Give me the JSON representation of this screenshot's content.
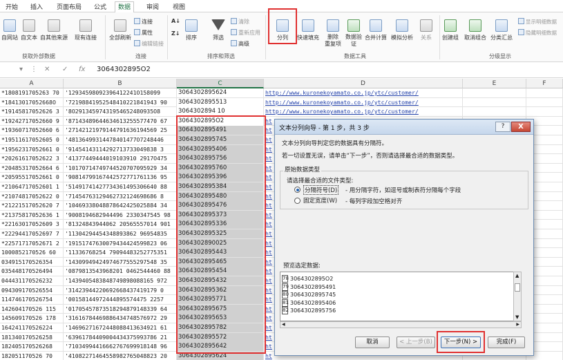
{
  "ribbon": {
    "tabs": [
      "开始",
      "插入",
      "页面布局",
      "公式",
      "数据",
      "审阅",
      "视图"
    ],
    "external": [
      "自网站",
      "自文本",
      "自其他来源",
      "现有连接"
    ],
    "refresh": "全部刷新",
    "connections": [
      "连接",
      "属性",
      "编辑链接"
    ],
    "sort": "排序",
    "filter": "筛选",
    "filter_small": [
      "清除",
      "重新应用",
      "高级"
    ],
    "text_to_columns": "分列",
    "tools": [
      "快速填充",
      "删除\n重复项",
      "数据验\n证",
      "合并计算",
      "模拟分析",
      "关系"
    ],
    "outline": [
      "创建组",
      "取消组合",
      "分类汇总"
    ],
    "outline_small": [
      "显示明细数据",
      "隐藏明细数据"
    ],
    "groups": [
      "获取外部数据",
      "连接",
      "排序和筛选",
      "数据工具",
      "分级显示"
    ]
  },
  "formula_bar": {
    "name_box": "",
    "value": "3064302895O2"
  },
  "columns": [
    "A",
    "B",
    "C",
    "D",
    "E",
    "F"
  ],
  "sheet": {
    "rows": [
      [
        "*1808191705263 70",
        "'12934598092396412241O158099",
        "3064302895624",
        "http://www.kuronekoyamato.co.jp/ytc/customer/"
      ],
      [
        "*18413017052668O",
        "'72198841952548410221841943 90",
        "3064302895513",
        "http://www.kuronekoyamato.co.jp/ytc/customer/"
      ],
      [
        "*19145817052626 3",
        "'8O29134597431954652480935O8",
        "3064302894 10",
        "http://www.kuronekoyamato.co.jp/ytc/customer/"
      ],
      [
        "*19242717052660 9",
        "'87143489644634613255577470 67",
        "3064302895O2",
        "ht"
      ],
      [
        "*19360717052660 6",
        "'27142121979144791636194569 25",
        "3064302895491",
        "ht"
      ],
      [
        "*19511617052605 0",
        "'48136499314478401477O7248446",
        "3064302895745",
        "ht"
      ],
      [
        "*19562317052661 0",
        "'91454143114292713733049838 3",
        "3064302895406",
        "ht"
      ],
      [
        "*20261617052622 3",
        "'41377449444019103910 2917O475",
        "3064302895756",
        "ht"
      ],
      [
        "*20485317052664 6",
        "'10170714749744520707095929 34",
        "3064302895760",
        "ht"
      ],
      [
        "*20595517052661 0",
        "'90814799167442572771761136 95",
        "3064302895396",
        "ht"
      ],
      [
        "*21064717052601 1",
        "'51491741427734361495306640 88",
        "3064302895384",
        "ht"
      ],
      [
        "*21074817052622 0",
        "'71454763129462732124698686 8",
        "3064302895480",
        "ht"
      ],
      [
        "*21221517052620 7",
        "'10469338048878642425025884 34",
        "3064302895476",
        "ht"
      ],
      [
        "*21375817052636 1",
        "'9008194682944496 2330347545 98",
        "3064302895373",
        "ht"
      ],
      [
        "*22163017052609 3",
        "'81324843944062 20565557014 901",
        "3064302895336",
        "ht"
      ],
      [
        "*22294417052697 7",
        "'11304294454348893862 96954835",
        "3064302895325",
        "ht"
      ],
      [
        "*22571717052671 2",
        "'19151747630079434424599823 06",
        "3064302890025",
        "ht"
      ],
      [
        "1000852170526 60",
        "'11336768254 79094483252775351",
        "3064302895443",
        "ht"
      ],
      [
        "034915170526354",
        "'14309949424974677555297548 35",
        "3064302895465",
        "ht"
      ],
      [
        "035448170526494",
        "'0879813543968201 0462544460 88",
        "3064302895454",
        "ht"
      ],
      [
        "044431170526232",
        "'1439405483848749898088165 972",
        "3064302895432",
        "ht"
      ],
      [
        "094309170526554",
        "'31423944220692668437419179 0",
        "3064302895362",
        "ht"
      ],
      [
        "114746170526754",
        "'00158144972444895574475 2257",
        "3064302895771",
        "ht"
      ],
      [
        "142604170526 115",
        "'01705457873518294879148339 64",
        "3064302895675",
        "ht"
      ],
      [
        "145609170526 178",
        "'31616784469886434748576972 29",
        "3064302895653",
        "ht"
      ],
      [
        "164241170526224",
        "'14696271672448088413634921 61",
        "3064302895782",
        "ht"
      ],
      [
        "181340170526258",
        "'63961784409004434375993786 21",
        "3064302895572",
        "ht"
      ],
      [
        "182405170526268",
        "'71034994416662767699918148 96",
        "3064302895642",
        "ht"
      ],
      [
        "182051170526 70",
        "'41082271464558982765048823 20",
        "3064302895624",
        "ht"
      ]
    ]
  },
  "dialog": {
    "title": "文本分列向导 - 第 1 步，共 3 步",
    "help": "?",
    "close": "X",
    "intro1": "文本分列向导判定您的数据具有分隔符。",
    "intro2": "若一切设置无误，请单击“下一步”，否则请选择最合适的数据类型。",
    "section": "原始数据类型",
    "prompt": "请选择最合适的文件类型:",
    "option1": "分隔符号(D)",
    "option1_desc": "- 用分隔字符，如逗号或制表符分隔每个字段",
    "option2": "固定宽度(W)",
    "option2_desc": "- 每列字段加空格对齐",
    "preview_label": "预览选定数据:",
    "preview_rows": [
      {
        "n": "78",
        "v": "3064302895O2"
      },
      {
        "n": "79",
        "v": "3064302895491"
      },
      {
        "n": "80",
        "v": "3064302895745"
      },
      {
        "n": "81",
        "v": "3064302895406"
      },
      {
        "n": "82",
        "v": "3064302895756"
      }
    ],
    "buttons": {
      "cancel": "取消",
      "back": "< 上一步(B)",
      "next": "下一步(N) >",
      "finish": "完成(F)"
    }
  },
  "colors": {
    "excel_green": "#217346",
    "highlight": "#e03030",
    "link": "#1f3ea8"
  }
}
